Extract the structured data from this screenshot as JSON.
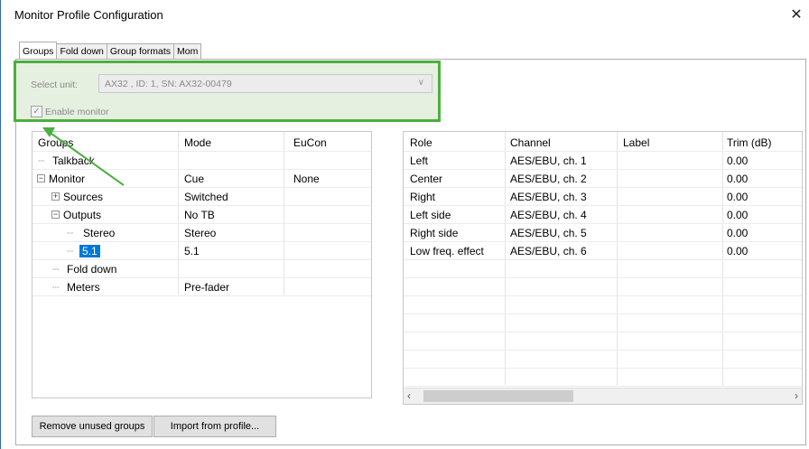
{
  "window": {
    "title": "Monitor Profile Configuration",
    "close_glyph": "✕"
  },
  "tabs": [
    {
      "label": "Groups",
      "active": true
    },
    {
      "label": "Fold down",
      "active": false
    },
    {
      "label": "Group formats",
      "active": false
    },
    {
      "label": "Mom",
      "active": false
    }
  ],
  "unit": {
    "label": "Select unit:",
    "selected": "AX32 , ID: 1, SN: AX32-00479",
    "enable_label": "Enable monitor",
    "enable_checked": true
  },
  "groups_table": {
    "headers": {
      "name": "Groups",
      "mode": "Mode",
      "eucon": "EuCon"
    },
    "rows": [
      {
        "name": "Talkback",
        "mode": "",
        "eucon": ""
      },
      {
        "name": "Monitor",
        "mode": "Cue",
        "eucon": "None"
      },
      {
        "name": "Sources",
        "mode": "Switched",
        "eucon": ""
      },
      {
        "name": "Outputs",
        "mode": "No TB",
        "eucon": ""
      },
      {
        "name": "Stereo",
        "mode": "Stereo",
        "eucon": ""
      },
      {
        "name": "5.1",
        "mode": "5.1",
        "eucon": ""
      },
      {
        "name": "Fold down",
        "mode": "",
        "eucon": ""
      },
      {
        "name": "Meters",
        "mode": "Pre-fader",
        "eucon": ""
      }
    ]
  },
  "roles_table": {
    "headers": {
      "role": "Role",
      "channel": "Channel",
      "label": "Label",
      "trim": "Trim (dB)"
    },
    "rows": [
      {
        "role": "Left",
        "channel": "AES/EBU, ch. 1",
        "label": "",
        "trim": "0.00"
      },
      {
        "role": "Center",
        "channel": "AES/EBU, ch. 2",
        "label": "",
        "trim": "0.00"
      },
      {
        "role": "Right",
        "channel": "AES/EBU, ch. 3",
        "label": "",
        "trim": "0.00"
      },
      {
        "role": "Left side",
        "channel": "AES/EBU, ch. 4",
        "label": "",
        "trim": "0.00"
      },
      {
        "role": "Right side",
        "channel": "AES/EBU, ch. 5",
        "label": "",
        "trim": "0.00"
      },
      {
        "role": "Low freq. effect",
        "channel": "AES/EBU, ch. 6",
        "label": "",
        "trim": "0.00"
      }
    ]
  },
  "buttons": {
    "remove_unused": "Remove unused groups",
    "import_profile": "Import from profile..."
  },
  "colors": {
    "highlight_border": "#4caf3f",
    "highlight_fill": "#e6f0e0",
    "selection": "#0078d7"
  }
}
